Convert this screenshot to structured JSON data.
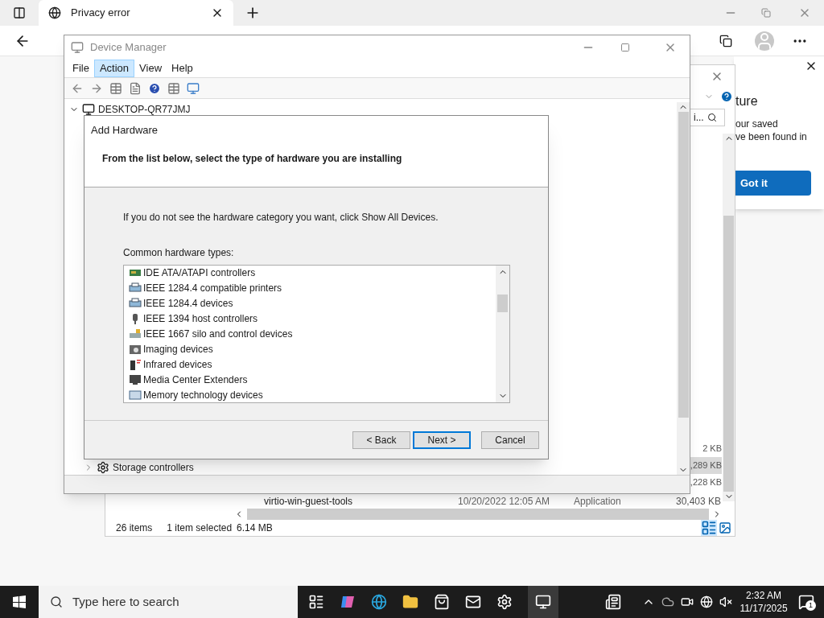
{
  "browser": {
    "tab_title": "Privacy error"
  },
  "popup": {
    "heading": "ture",
    "lines": [
      "our saved",
      "ve been found in"
    ],
    "button": "Got it"
  },
  "explorer": {
    "search_value": "i...",
    "rows": [
      {
        "size": "2 KB",
        "selected": false
      },
      {
        "size": ",289 KB",
        "selected": true
      },
      {
        "size": ",228 KB",
        "selected": false
      },
      {
        "name": "virtio-win-guest-tools",
        "date": "10/20/2022 12:05 AM",
        "type": "Application",
        "size": "30,403 KB",
        "selected": false
      }
    ],
    "status": [
      "26 items",
      "1 item selected",
      "6.14 MB"
    ]
  },
  "device_manager": {
    "title": "Device Manager",
    "menu": [
      {
        "label": "File",
        "selected": false
      },
      {
        "label": "Action",
        "selected": true
      },
      {
        "label": "View",
        "selected": false
      },
      {
        "label": "Help",
        "selected": false
      }
    ],
    "tree_root": "DESKTOP-QR77JMJ",
    "tree_items": [
      "Storage controllers"
    ]
  },
  "dialog": {
    "title": "Add Hardware",
    "heading": "From the list below, select the type of hardware you are installing",
    "instruction": "If you do not see the hardware category you want, click Show All Devices.",
    "list_label": "Common hardware types:",
    "items": [
      {
        "label": "IDE ATA/ATAPI controllers",
        "kind": "controller"
      },
      {
        "label": "IEEE 1284.4 compatible printers",
        "kind": "printer"
      },
      {
        "label": "IEEE 1284.4 devices",
        "kind": "printer"
      },
      {
        "label": "IEEE 1394 host controllers",
        "kind": "plug"
      },
      {
        "label": "IEEE 1667 silo and control devices",
        "kind": "storage"
      },
      {
        "label": "Imaging devices",
        "kind": "camera"
      },
      {
        "label": "Infrared devices",
        "kind": "infrared"
      },
      {
        "label": "Media Center Extenders",
        "kind": "monitor"
      },
      {
        "label": "Memory technology devices",
        "kind": "memory"
      }
    ],
    "buttons": [
      {
        "label": "< Back",
        "default": false
      },
      {
        "label": "Next >",
        "default": true
      },
      {
        "label": "Cancel",
        "default": false
      }
    ]
  },
  "taskbar": {
    "search_placeholder": "Type here to search",
    "time": "2:32 AM",
    "date": "11/17/2025",
    "notifications": "1"
  }
}
